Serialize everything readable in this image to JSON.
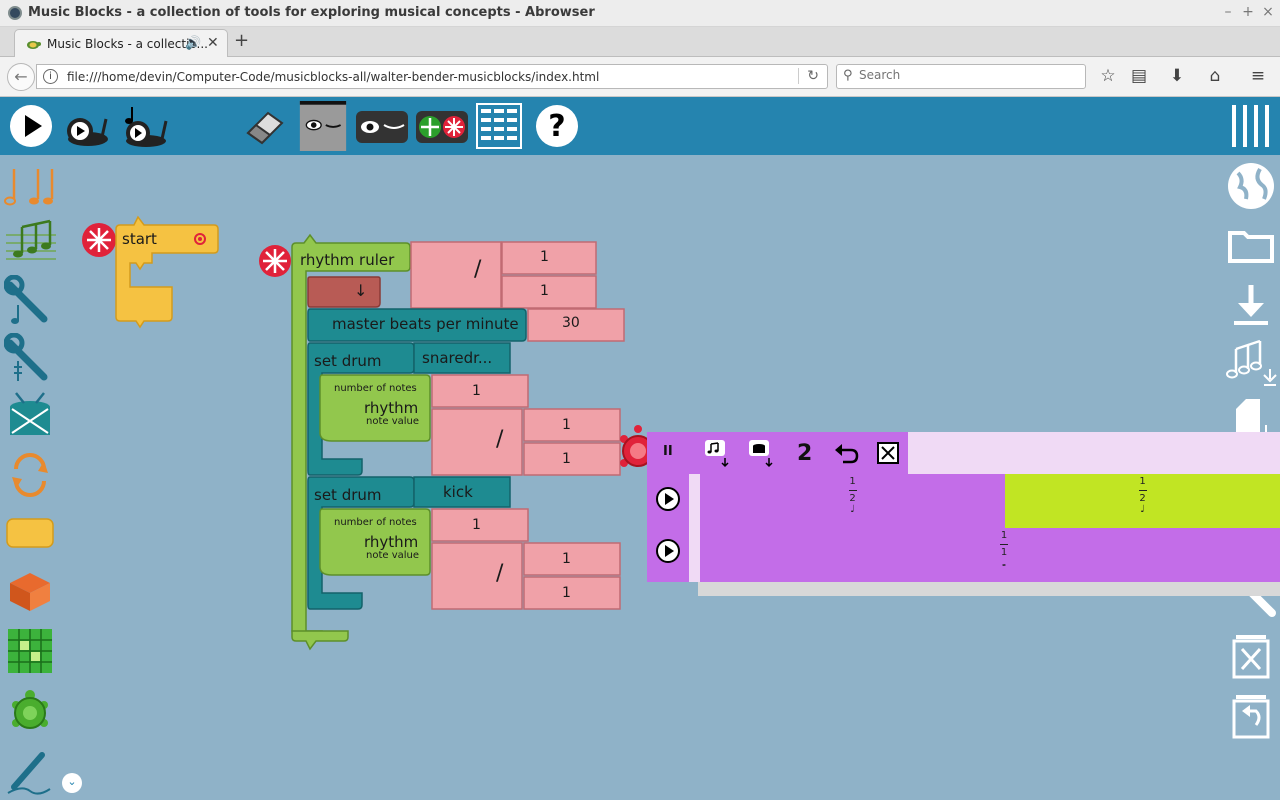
{
  "window": {
    "title": "Music Blocks - a collection of tools for exploring musical concepts - Abrowser",
    "minimize": "–",
    "maximize": "+",
    "close": "×"
  },
  "tab": {
    "label": "Music Blocks - a collectio...",
    "new_tab": "+"
  },
  "nav": {
    "url": "file:///home/devin/Computer-Code/musicblocks-all/walter-bender-musicblocks/index.html",
    "search_placeholder": "Search"
  },
  "blocks": {
    "start": "start",
    "rhythm_ruler": "rhythm ruler",
    "divide": "/",
    "ruler_num": "1",
    "ruler_den": "1",
    "down_arrow": "↓",
    "master_bpm": "master beats per minute",
    "bpm_value": "30",
    "set_drum_1": "set drum",
    "drum_1": "snaredr...",
    "number_of_notes_1": "number of notes",
    "rhythm_1": "rhythm",
    "note_value_1": "note value",
    "notes_count_1": "1",
    "nv_num_1": "1",
    "nv_den_1": "1",
    "set_drum_2": "set drum",
    "drum_2": "kick",
    "number_of_notes_2": "number of notes",
    "rhythm_2": "rhythm",
    "note_value_2": "note value",
    "notes_count_2": "1",
    "nv_num_2": "1",
    "nv_den_2": "1"
  },
  "rhythm_widget": {
    "pause": "II",
    "tuplet_count": "2",
    "row1_cells": [
      {
        "num": "1",
        "den": "2",
        "note": "♩"
      },
      {
        "num": "1",
        "den": "2",
        "note": "♩"
      }
    ],
    "row2_cells": [
      {
        "num": "1",
        "den": "1",
        "note": "𝅝"
      }
    ]
  },
  "colors": {
    "toolbar": "#2584af",
    "canvas": "#8fb2c8",
    "widget_purple": "#c36de8",
    "widget_light": "#f0daf5",
    "cell_highlight": "#c1e523",
    "block_green": "#92c74d",
    "block_teal": "#1e8b91",
    "block_pink": "#f0a1a8",
    "block_yellow": "#f5c242"
  }
}
